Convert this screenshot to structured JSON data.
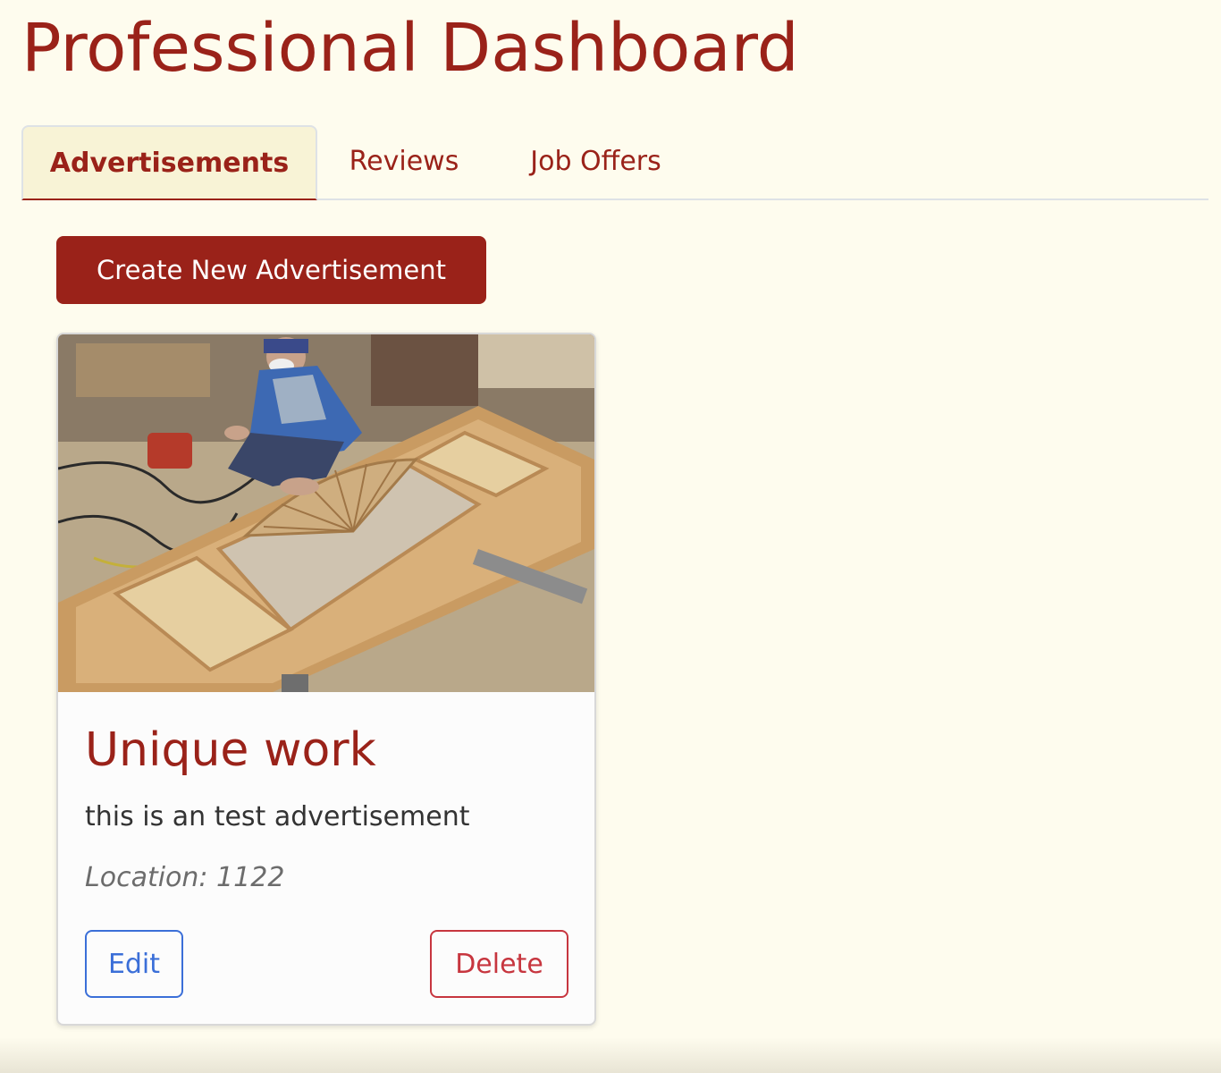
{
  "header": {
    "title": "Professional Dashboard"
  },
  "tabs": [
    {
      "label": "Advertisements",
      "active": true
    },
    {
      "label": "Reviews",
      "active": false
    },
    {
      "label": "Job Offers",
      "active": false
    }
  ],
  "actions": {
    "create_label": "Create New Advertisement"
  },
  "advertisements": [
    {
      "title": "Unique work",
      "description": "this is an test advertisement",
      "location": "Location: 1122",
      "edit_label": "Edit",
      "delete_label": "Delete"
    }
  ],
  "colors": {
    "background": "#fefcee",
    "brand": "#9a2219",
    "active_tab": "#f8f3d6",
    "edit": "#3b6fd8",
    "delete": "#c7363f"
  }
}
